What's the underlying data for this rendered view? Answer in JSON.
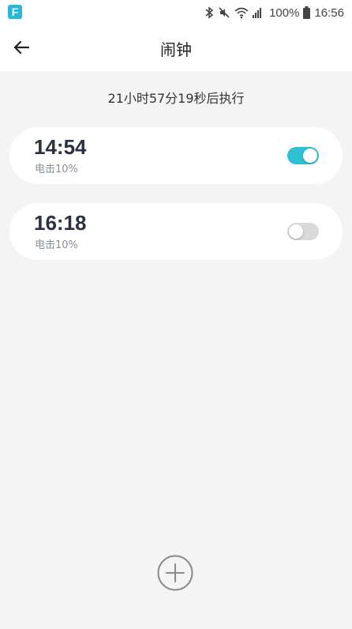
{
  "status_bar": {
    "app_icon_letter": "F",
    "battery_percent": "100%",
    "time": "16:56"
  },
  "header": {
    "title": "闹钟",
    "back_icon": "arrow-left-icon"
  },
  "countdown_text": "21小时57分19秒后执行",
  "alarms": [
    {
      "time": "14:54",
      "description": "电击10%",
      "enabled": true
    },
    {
      "time": "16:18",
      "description": "电击10%",
      "enabled": false
    }
  ],
  "colors": {
    "accent": "#2ec1d3",
    "toggle_off": "#d9d9d9",
    "background": "#f4f4f4",
    "card": "#ffffff",
    "app_icon": "#2bb7d6"
  },
  "add_button_icon": "plus-circle-icon"
}
